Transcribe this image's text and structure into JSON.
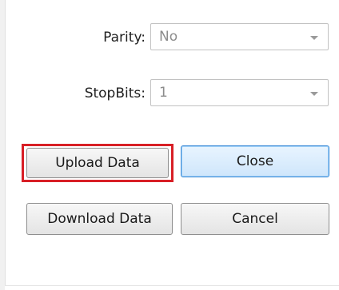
{
  "form": {
    "parity": {
      "label": "Parity:",
      "value": "No"
    },
    "stopbits": {
      "label": "StopBits:",
      "value": "1"
    }
  },
  "buttons": {
    "upload": "Upload Data",
    "close": "Close",
    "download": "Download Data",
    "cancel": "Cancel"
  },
  "colors": {
    "highlight": "#d81f26",
    "default_button_border": "#3c8ad6"
  },
  "icons": {
    "dropdown": "chevron-down-icon"
  }
}
